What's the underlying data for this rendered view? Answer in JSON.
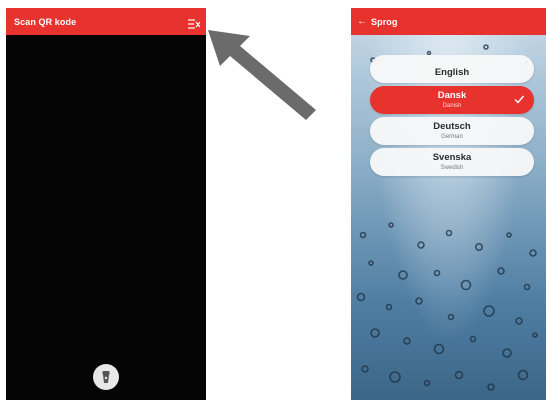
{
  "scanner": {
    "title": "Scan QR kode",
    "menu_icon": "menu-close-icon",
    "flash_icon": "flashlight-icon"
  },
  "language_screen": {
    "back_icon": "←",
    "title": "Sprog",
    "languages": [
      {
        "name": "English",
        "native": ""
      },
      {
        "name": "Dansk",
        "native": "Danish",
        "selected": true
      },
      {
        "name": "Deutsch",
        "native": "German"
      },
      {
        "name": "Svenska",
        "native": "Swedish"
      }
    ],
    "selected_check_icon": "checkmark-icon"
  },
  "colors": {
    "brand_red": "#e8322e",
    "scanner_bg": "#050505",
    "arrow": "#6b6b6b"
  }
}
